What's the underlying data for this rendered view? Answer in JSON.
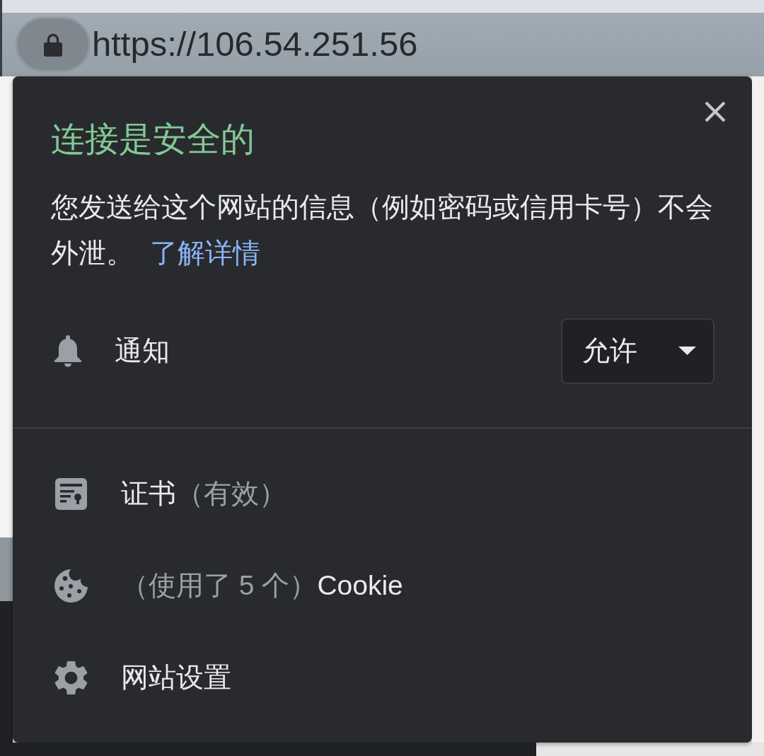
{
  "address_bar": {
    "url": "https://106.54.251.56"
  },
  "site_info_popup": {
    "title": "连接是安全的",
    "description": "您发送给这个网站的信息（例如密码或信用卡号）不会外泄。",
    "learn_more_link": "了解详情",
    "permissions": [
      {
        "kind": "notifications",
        "label": "通知",
        "value": "允许"
      }
    ],
    "items": [
      {
        "kind": "certificate",
        "parts": [
          {
            "text": "证书",
            "muted": false
          },
          {
            "text": "（有效）",
            "muted": true
          }
        ]
      },
      {
        "kind": "cookies",
        "parts": [
          {
            "text": "（使用了 5 个）",
            "muted": true
          },
          {
            "text": "Cookie",
            "muted": false
          }
        ]
      },
      {
        "kind": "site_settings",
        "parts": [
          {
            "text": "网站设置",
            "muted": false
          }
        ]
      }
    ]
  }
}
